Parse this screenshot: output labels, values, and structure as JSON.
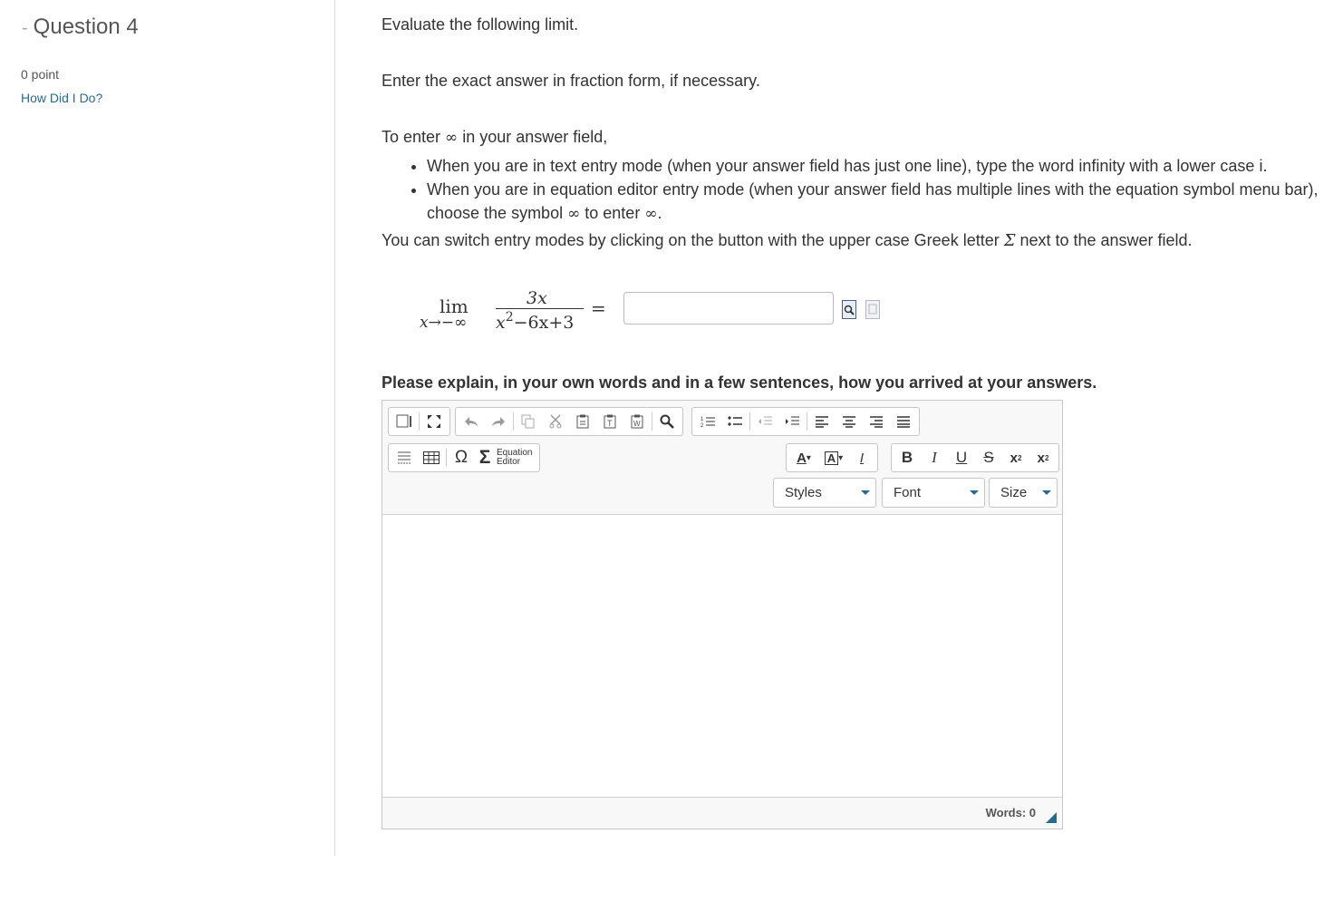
{
  "question": {
    "title": "Question 4",
    "collapse_glyph": "-",
    "points": "0 point",
    "help_link": "How Did I Do?"
  },
  "instructions": {
    "line1": "Evaluate the following limit.",
    "line2": "Enter the exact answer in fraction form, if necessary.",
    "line3_pre": "To enter ",
    "infinity": "∞",
    "line3_post": " in your answer field,",
    "bullet1": "When you are in text entry mode (when your answer field has just one line), type the word infinity with a lower case i.",
    "bullet2_pre": "When you are in equation editor entry mode (when your answer field has multiple lines with the equation symbol menu bar), choose the symbol ",
    "bullet2_mid": " to enter ",
    "bullet2_post": ".",
    "line4_pre": "You can switch entry modes by clicking on the button with the upper case Greek letter ",
    "sigma": "Σ",
    "line4_post": " next to the answer field."
  },
  "math": {
    "lim": "lim",
    "lim_sub": "x→−∞",
    "numerator": "3x",
    "den_x": "x",
    "den_exp": "2",
    "den_rest": "−6x+3",
    "equals": "="
  },
  "answer": {
    "value": "",
    "placeholder": ""
  },
  "icons": {
    "preview": "preview-document-icon",
    "paste": "paste-document-icon"
  },
  "explain": {
    "label": "Please explain, in your own words and in a few sentences, how you arrived at your answers."
  },
  "editor": {
    "toolbar_row1": [
      "source-icon",
      "maximize-icon",
      "undo-icon",
      "redo-icon",
      "copy-icon",
      "cut-icon",
      "paste-icon",
      "paste-text-icon",
      "paste-word-icon",
      "find-icon",
      "numbered-list-icon",
      "bulleted-list-icon",
      "outdent-icon",
      "indent-icon",
      "align-left-icon",
      "align-center-icon",
      "align-right-icon",
      "justify-icon"
    ],
    "omega": "Ω",
    "sigma": "Σ",
    "equation_editor": [
      "Equation",
      "Editor"
    ],
    "text_color": "A",
    "bg_color": "A",
    "remove_format": "I",
    "bold": "B",
    "italic": "I",
    "underline": "U",
    "strike": "S",
    "subscript": "x",
    "superscript": "x",
    "styles_label": "Styles",
    "font_label": "Font",
    "size_label": "Size",
    "content": "",
    "words": "Words: 0"
  },
  "colors": {
    "link": "#2a6a8f",
    "text": "#333333",
    "border": "#c6c6c6"
  }
}
